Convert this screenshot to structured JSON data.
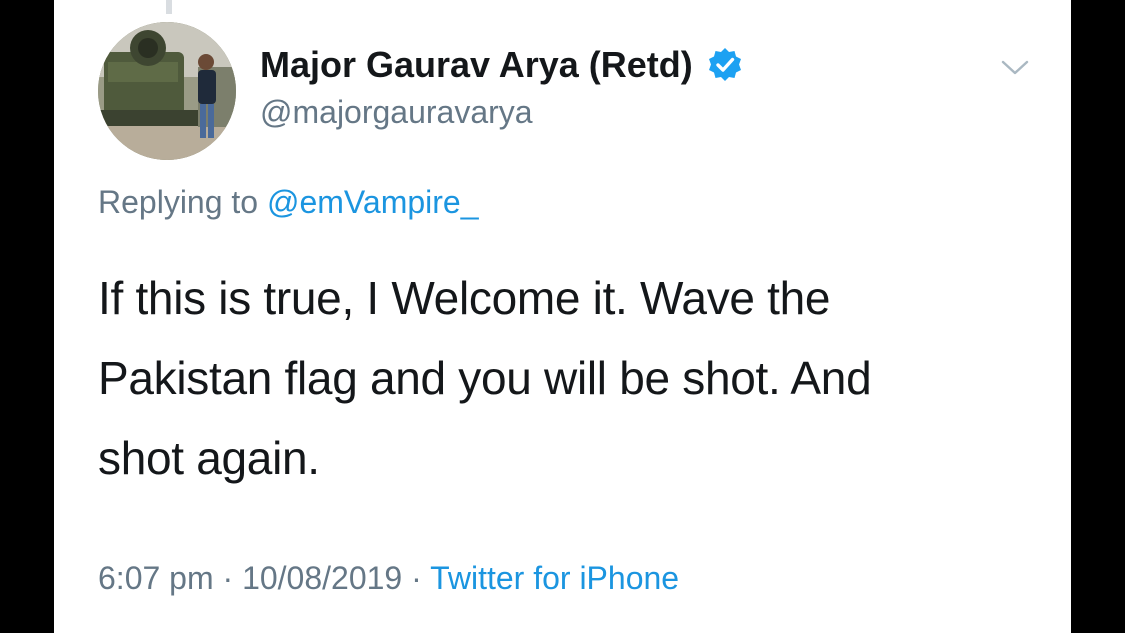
{
  "tweet": {
    "author": {
      "display_name": "Major Gaurav Arya (Retd)",
      "handle": "@majorgauravarya",
      "verified": true
    },
    "reply": {
      "prefix": "Replying to",
      "mention": "@emVampire_"
    },
    "text_lines": [
      "If this is true, I Welcome it. Wave the",
      "Pakistan flag and you will be shot. And",
      "shot again."
    ],
    "meta": {
      "time": "6:07 pm",
      "separator": "·",
      "date": "10/08/2019",
      "source": "Twitter for iPhone"
    }
  },
  "icons": {
    "verified": "verified-badge-icon",
    "menu": "chevron-down-icon"
  },
  "colors": {
    "background": "#ffffff",
    "frame": "#000000",
    "primary_text": "#14171a",
    "secondary_text": "#657786",
    "link": "#1b95e0",
    "verified_badge": "#1da1f2"
  }
}
